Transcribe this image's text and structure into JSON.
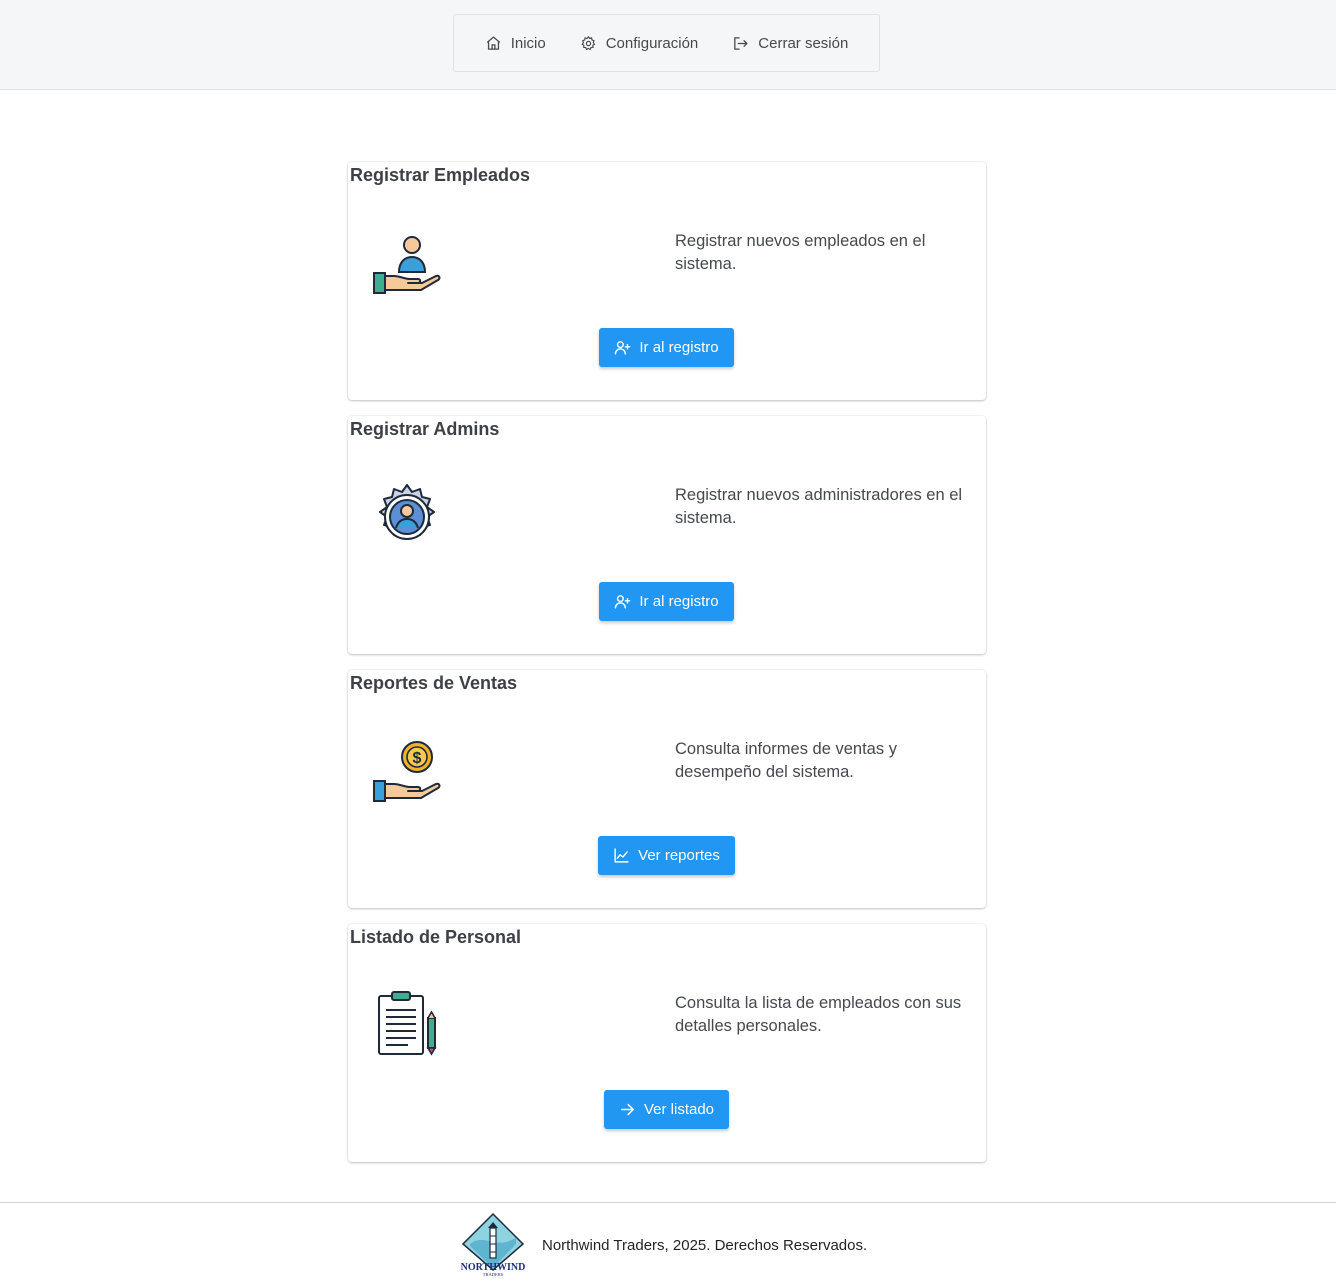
{
  "nav": {
    "items": [
      {
        "label": "Inicio",
        "icon": "home-icon"
      },
      {
        "label": "Configuración",
        "icon": "gear-icon"
      },
      {
        "label": "Cerrar sesión",
        "icon": "logout-icon"
      }
    ]
  },
  "cards": [
    {
      "title": "Registrar Empleados",
      "description": "Registrar nuevos empleados en el sistema.",
      "icon": "employee-hand-icon",
      "button": {
        "label": "Ir al registro",
        "icon": "user-plus-icon"
      }
    },
    {
      "title": "Registrar Admins",
      "description": "Registrar nuevos administradores en el sistema.",
      "icon": "admin-gear-icon",
      "button": {
        "label": "Ir al registro",
        "icon": "user-plus-icon"
      }
    },
    {
      "title": "Reportes de Ventas",
      "description": "Consulta informes de ventas y desempeño del sistema.",
      "icon": "coin-hand-icon",
      "button": {
        "label": "Ver reportes",
        "icon": "chart-line-icon"
      }
    },
    {
      "title": "Listado de Personal",
      "description": "Consulta la lista de empleados con sus detalles personales.",
      "icon": "clipboard-icon",
      "button": {
        "label": "Ver listado",
        "icon": "arrow-right-icon"
      }
    }
  ],
  "footer": {
    "text": "Northwind Traders, 2025. Derechos Reservados.",
    "logo_text": "NORTHWIND",
    "logo_subtext": "TRADERS"
  },
  "colors": {
    "accent": "#2196f3",
    "topbar": "#f5f6f7"
  }
}
